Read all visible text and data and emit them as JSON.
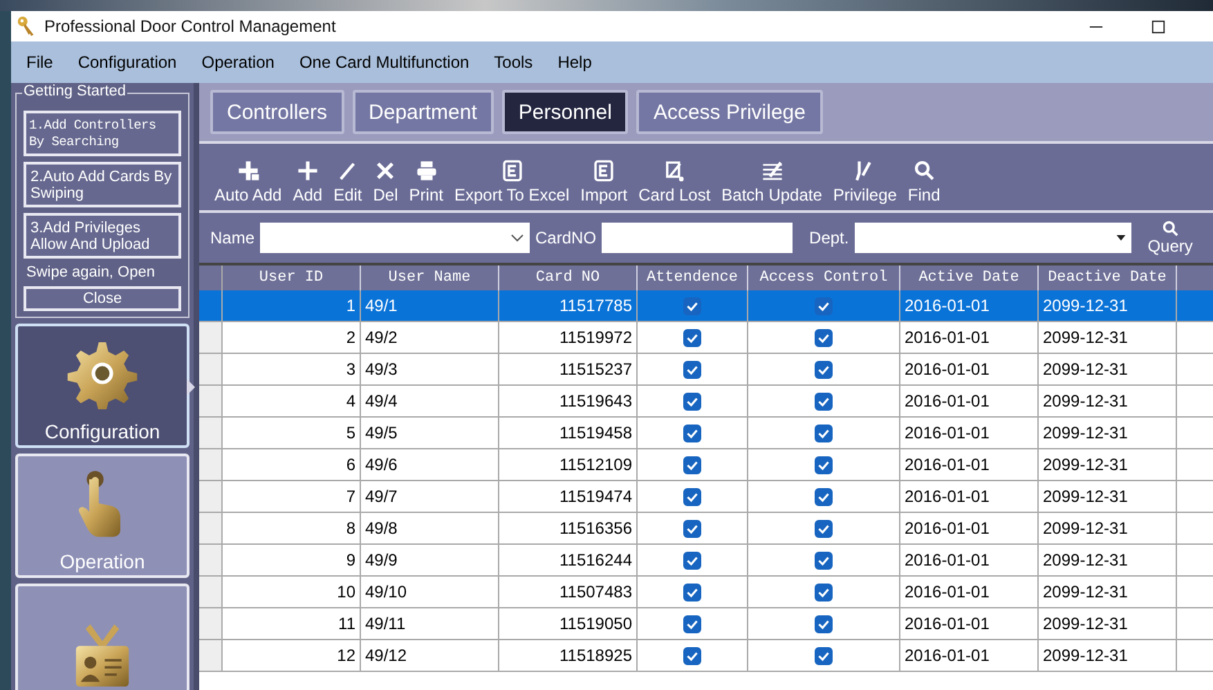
{
  "window": {
    "title": "Professional Door Control Management"
  },
  "menu": [
    "File",
    "Configuration",
    "Operation",
    "One Card Multifunction",
    "Tools",
    "Help"
  ],
  "getting_started": {
    "title": "Getting Started",
    "steps": [
      "1.Add Controllers By Searching",
      "2.Auto Add Cards By Swiping",
      "3.Add Privileges Allow And Upload"
    ],
    "note": "Swipe again, Open",
    "close": "Close"
  },
  "nav": [
    {
      "label": "Configuration",
      "selected": true
    },
    {
      "label": "Operation",
      "selected": false
    },
    {
      "selected": false
    }
  ],
  "tabs": [
    {
      "label": "Controllers",
      "selected": false
    },
    {
      "label": "Department",
      "selected": false
    },
    {
      "label": "Personnel",
      "selected": true
    },
    {
      "label": "Access Privilege",
      "selected": false
    }
  ],
  "toolbar": [
    "Auto Add",
    "Add",
    "Edit",
    "Del",
    "Print",
    "Export To Excel",
    "Import",
    "Card Lost",
    "Batch Update",
    "Privilege",
    "Find"
  ],
  "filters": {
    "name_label": "Name",
    "cardno_label": "CardNO",
    "dept_label": "Dept.",
    "query": "Query"
  },
  "table": {
    "columns": [
      "User ID",
      "User Name",
      "Card NO",
      "Attendence",
      "Access Control",
      "Active Date",
      "Deactive Date"
    ],
    "rows": [
      {
        "id": "1",
        "name": "49/1",
        "card": "11517785",
        "attendance": true,
        "access": true,
        "active": "2016-01-01",
        "deactive": "2099-12-31",
        "selected": true
      },
      {
        "id": "2",
        "name": "49/2",
        "card": "11519972",
        "attendance": true,
        "access": true,
        "active": "2016-01-01",
        "deactive": "2099-12-31",
        "selected": false
      },
      {
        "id": "3",
        "name": "49/3",
        "card": "11515237",
        "attendance": true,
        "access": true,
        "active": "2016-01-01",
        "deactive": "2099-12-31",
        "selected": false
      },
      {
        "id": "4",
        "name": "49/4",
        "card": "11519643",
        "attendance": true,
        "access": true,
        "active": "2016-01-01",
        "deactive": "2099-12-31",
        "selected": false
      },
      {
        "id": "5",
        "name": "49/5",
        "card": "11519458",
        "attendance": true,
        "access": true,
        "active": "2016-01-01",
        "deactive": "2099-12-31",
        "selected": false
      },
      {
        "id": "6",
        "name": "49/6",
        "card": "11512109",
        "attendance": true,
        "access": true,
        "active": "2016-01-01",
        "deactive": "2099-12-31",
        "selected": false
      },
      {
        "id": "7",
        "name": "49/7",
        "card": "11519474",
        "attendance": true,
        "access": true,
        "active": "2016-01-01",
        "deactive": "2099-12-31",
        "selected": false
      },
      {
        "id": "8",
        "name": "49/8",
        "card": "11516356",
        "attendance": true,
        "access": true,
        "active": "2016-01-01",
        "deactive": "2099-12-31",
        "selected": false
      },
      {
        "id": "9",
        "name": "49/9",
        "card": "11516244",
        "attendance": true,
        "access": true,
        "active": "2016-01-01",
        "deactive": "2099-12-31",
        "selected": false
      },
      {
        "id": "10",
        "name": "49/10",
        "card": "11507483",
        "attendance": true,
        "access": true,
        "active": "2016-01-01",
        "deactive": "2099-12-31",
        "selected": false
      },
      {
        "id": "11",
        "name": "49/11",
        "card": "11519050",
        "attendance": true,
        "access": true,
        "active": "2016-01-01",
        "deactive": "2099-12-31",
        "selected": false
      },
      {
        "id": "12",
        "name": "49/12",
        "card": "11518925",
        "attendance": true,
        "access": true,
        "active": "2016-01-01",
        "deactive": "2099-12-31",
        "selected": false
      }
    ]
  }
}
